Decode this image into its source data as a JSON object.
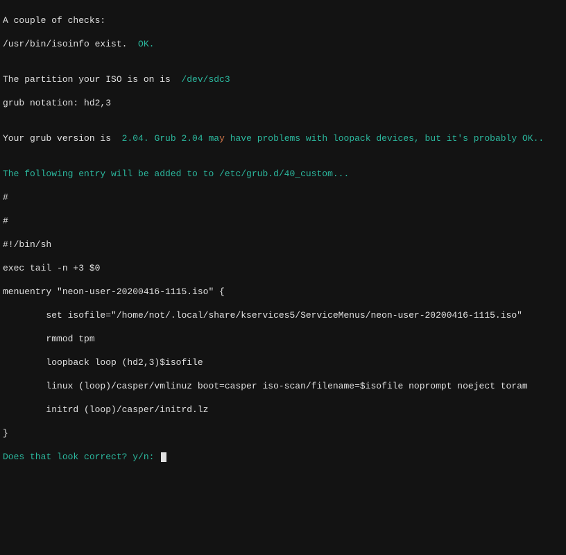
{
  "lines": {
    "l1": "A couple of checks:",
    "l2a": "/usr/bin/isoinfo exist.  ",
    "l2b": "OK.",
    "l3": "",
    "l4a": "The partition your ISO is on is  ",
    "l4b": "/dev/sdc3",
    "l5": "grub notation: hd2,3",
    "l6": "",
    "l7a": "Your grub version is  ",
    "l7b": "2.04. Grub 2.04 ma",
    "l7c": "y",
    "l7d": " have problems with loopack devices, but it's probably OK..",
    "l8": "",
    "l9": "The following entry will be added to to /etc/grub.d/40_custom...",
    "l10": "#",
    "l11": "#",
    "l12": "#!/bin/sh",
    "l13": "exec tail -n +3 $0",
    "l14": "menuentry \"neon-user-20200416-1115.iso\" {",
    "l15": "        set isofile=\"/home/not/.local/share/kservices5/ServiceMenus/neon-user-20200416-1115.iso\"",
    "l16": "        rmmod tpm",
    "l17": "        loopback loop (hd2,3)$isofile",
    "l18": "        linux (loop)/casper/vmlinuz boot=casper iso-scan/filename=$isofile noprompt noeject toram",
    "l19": "        initrd (loop)/casper/initrd.lz",
    "l20": "}",
    "l21": "Does that look correct? y/n: "
  }
}
